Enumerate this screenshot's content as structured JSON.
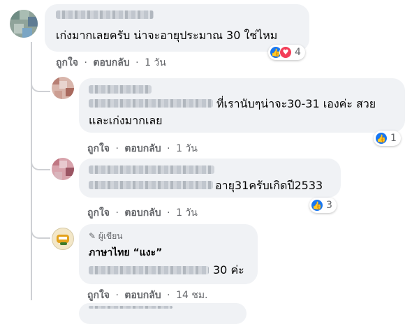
{
  "comments": [
    {
      "text": "เก่งมากเลยครับ น่าจะอายุประมาณ 30 ใช่ไหม",
      "like_label": "ถูกใจ",
      "reply_label": "ตอบกลับ",
      "time": "1 วัน",
      "reaction_count": "4",
      "reaction_icons": [
        "like-icon",
        "love-icon"
      ]
    },
    {
      "text_line1": "ที่เรานับๆน่าจะ30-31 เองค่ะ สวย",
      "text_line2": "และเก่งมากเลย",
      "like_label": "ถูกใจ",
      "reply_label": "ตอบกลับ",
      "time": "1 วัน",
      "reaction_count": "1",
      "reaction_icons": [
        "like-icon"
      ]
    },
    {
      "text": "อายุ31ครับเกิดปี2533",
      "like_label": "ถูกใจ",
      "reply_label": "ตอบกลับ",
      "time": "1 วัน",
      "reaction_count": "3",
      "reaction_icons": [
        "like-icon"
      ]
    },
    {
      "author_badge": "ผู้เขียน",
      "author_name": "ภาษาไทย “แงะ”",
      "text": "30 ค่ะ",
      "like_label": "ถูกใจ",
      "reply_label": "ตอบกลับ",
      "time": "14 ชม."
    }
  ],
  "separator": "·",
  "colors": {
    "bubble": "#f0f2f5",
    "meta": "#65676b",
    "like_blue": "#1877f2",
    "love_red": "#f33e58"
  }
}
